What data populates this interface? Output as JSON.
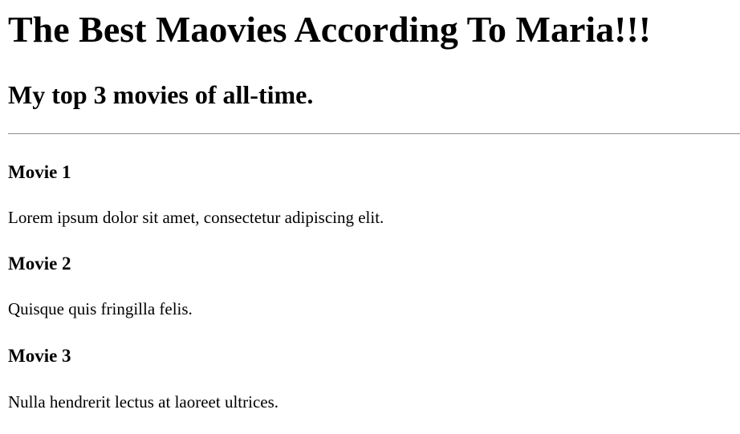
{
  "page": {
    "title": "The Best Maovies According To Maria!!!",
    "subtitle": "My top 3 movies of all-time."
  },
  "movies": [
    {
      "heading": "Movie 1",
      "description": "Lorem ipsum dolor sit amet, consectetur adipiscing elit."
    },
    {
      "heading": "Movie 2",
      "description": "Quisque quis fringilla felis."
    },
    {
      "heading": "Movie 3",
      "description": "Nulla hendrerit lectus at laoreet ultrices."
    }
  ]
}
